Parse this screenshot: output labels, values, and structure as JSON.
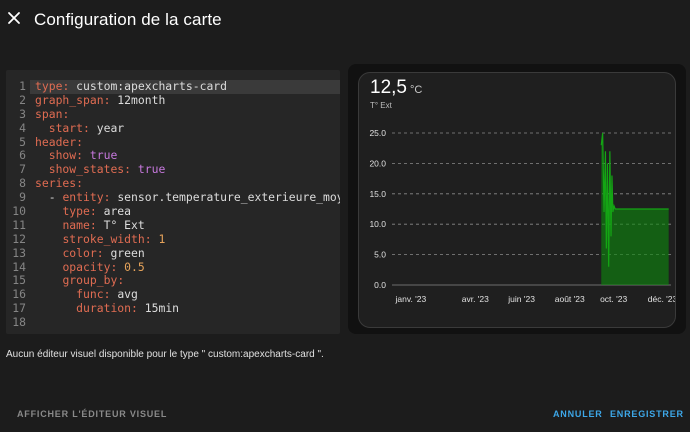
{
  "dialog": {
    "title": "Configuration de la carte",
    "close_icon": "close-icon"
  },
  "editor": {
    "lines": [
      {
        "n": "1",
        "indent": "",
        "key": "type",
        "value": "custom:apexcharts-card",
        "vtype": "str"
      },
      {
        "n": "2",
        "indent": "",
        "key": "graph_span",
        "value": "12month",
        "vtype": "str"
      },
      {
        "n": "3",
        "indent": "",
        "key": "span",
        "value": "",
        "vtype": "str"
      },
      {
        "n": "4",
        "indent": "  ",
        "key": "start",
        "value": "year",
        "vtype": "str"
      },
      {
        "n": "5",
        "indent": "",
        "key": "header",
        "value": "",
        "vtype": "str"
      },
      {
        "n": "6",
        "indent": "  ",
        "key": "show",
        "value": "true",
        "vtype": "bool"
      },
      {
        "n": "7",
        "indent": "  ",
        "key": "show_states",
        "value": "true",
        "vtype": "bool"
      },
      {
        "n": "8",
        "indent": "",
        "key": "series",
        "value": "",
        "vtype": "str"
      },
      {
        "n": "9",
        "indent": "  - ",
        "key": "entity",
        "value": "sensor.temperature_exterieure_moyenne",
        "vtype": "str"
      },
      {
        "n": "10",
        "indent": "    ",
        "key": "type",
        "value": "area",
        "vtype": "str"
      },
      {
        "n": "11",
        "indent": "    ",
        "key": "name",
        "value": "T° Ext",
        "vtype": "str"
      },
      {
        "n": "12",
        "indent": "    ",
        "key": "stroke_width",
        "value": "1",
        "vtype": "num"
      },
      {
        "n": "13",
        "indent": "    ",
        "key": "color",
        "value": "green",
        "vtype": "str"
      },
      {
        "n": "14",
        "indent": "    ",
        "key": "opacity",
        "value": "0.5",
        "vtype": "num"
      },
      {
        "n": "15",
        "indent": "    ",
        "key": "group_by",
        "value": "",
        "vtype": "str"
      },
      {
        "n": "16",
        "indent": "      ",
        "key": "func",
        "value": "avg",
        "vtype": "str"
      },
      {
        "n": "17",
        "indent": "      ",
        "key": "duration",
        "value": "15min",
        "vtype": "str"
      },
      {
        "n": "18",
        "indent": "",
        "key": "",
        "value": "",
        "vtype": "str"
      }
    ]
  },
  "card": {
    "state_value": "12,5",
    "state_unit": "°C",
    "series_name": "T° Ext",
    "series_color": "#0e8a0e"
  },
  "chart_data": {
    "type": "area",
    "title": "",
    "xlabel": "",
    "ylabel": "",
    "ylim": [
      0,
      25
    ],
    "yticks": [
      "0.0",
      "5.0",
      "10.0",
      "15.0",
      "20.0",
      "25.0"
    ],
    "x_range": [
      0,
      12
    ],
    "xticks": [
      {
        "x": 0.15,
        "label": "janv. '23"
      },
      {
        "x": 3.0,
        "label": "avr. '23"
      },
      {
        "x": 5.0,
        "label": "juin '23"
      },
      {
        "x": 7.0,
        "label": "août '23"
      },
      {
        "x": 8.95,
        "label": "oct. '23"
      },
      {
        "x": 11.0,
        "label": "déc. '23"
      }
    ],
    "grid": true,
    "series": [
      {
        "name": "T° Ext",
        "x": [
          9.0,
          9.06,
          9.12,
          9.18,
          9.22,
          9.27,
          9.32,
          9.37,
          9.42,
          9.46,
          9.5,
          9.55,
          9.6,
          9.65,
          9.72,
          9.8,
          9.9,
          10.2,
          11.0,
          11.9
        ],
        "y": [
          23.0,
          25.0,
          12.0,
          22.0,
          6.0,
          20.0,
          3.0,
          22.0,
          8.0,
          18.0,
          12.0,
          13.0,
          12.5,
          12.5,
          12.5,
          12.5,
          12.5,
          12.5,
          12.5,
          12.5
        ]
      }
    ]
  },
  "messages": {
    "no_visual_editor": "Aucun éditeur visuel disponible pour le type \" custom:apexcharts-card \"."
  },
  "footer": {
    "show_visual_editor": "Afficher l'éditeur visuel",
    "cancel": "Annuler",
    "save": "Enregistrer"
  }
}
